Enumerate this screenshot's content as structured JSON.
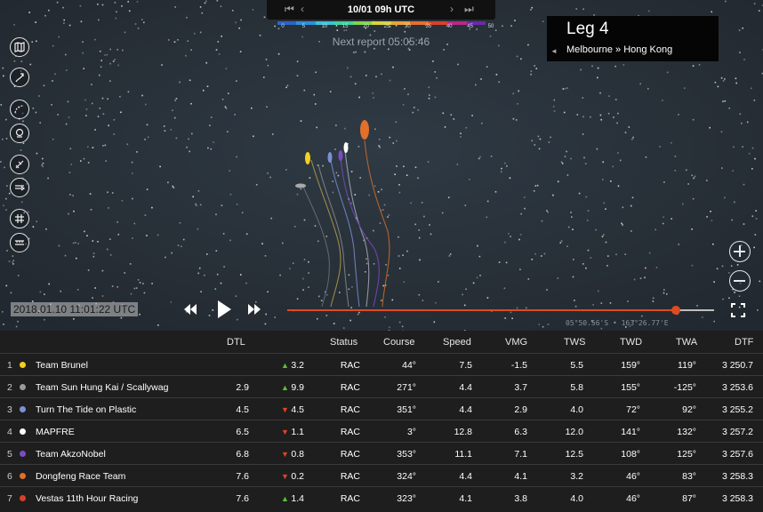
{
  "header": {
    "date": "10/01 09h UTC",
    "next_report": "Next report 05:05:46",
    "nav": {
      "first": "⏮",
      "prev": "‹",
      "next": "›",
      "last": "⏭"
    }
  },
  "wind_scale": {
    "labels": [
      "0",
      "5",
      "10",
      "15",
      "20",
      "25",
      "30",
      "35",
      "40",
      "45",
      "50"
    ],
    "colors": [
      "#2b64c8",
      "#2e8fd8",
      "#38c4d8",
      "#3fd39c",
      "#7fd44c",
      "#d9d43a",
      "#e8a33a",
      "#e3702e",
      "#d8402c",
      "#b8288a",
      "#6a2aa8"
    ]
  },
  "leg": {
    "title": "Leg 4",
    "route": "Melbourne » Hong Kong",
    "collapse": "◄"
  },
  "left_tools": [
    {
      "name": "map-layers-icon"
    },
    {
      "name": "boat-tracks-icon"
    },
    {
      "name": "routing-icon"
    },
    {
      "name": "boat-focus-icon"
    },
    {
      "name": "wind-icon"
    },
    {
      "name": "currents-icon"
    },
    {
      "name": "grid-icon"
    },
    {
      "name": "ruler-icon"
    }
  ],
  "playback": {
    "time": "2018.01.10 11:01:22 UTC",
    "progress": 0.91,
    "coords": "05°50.56'S • 163°26.77'E"
  },
  "boats_on_map": [
    {
      "color": "#f2d01e",
      "name": "brunel"
    },
    {
      "color": "#a9a9a9",
      "name": "scallywag"
    },
    {
      "color": "#7b90d6",
      "name": "turn-the-tide"
    },
    {
      "color": "#ffffff",
      "name": "mapfre"
    },
    {
      "color": "#7a4cc4",
      "name": "akzonobel"
    },
    {
      "color": "#e0702a",
      "name": "dongfeng"
    }
  ],
  "table": {
    "columns": [
      "DTL",
      "Status",
      "Course",
      "Speed",
      "VMG",
      "TWS",
      "TWD",
      "TWA",
      "DTF"
    ],
    "rows": [
      {
        "rank": "1",
        "color": "#f2d01e",
        "team": "Team Brunel",
        "dtl": "",
        "trend": "up",
        "change": "3.2",
        "status": "RAC",
        "course": "44°",
        "speed": "7.5",
        "vmg": "-1.5",
        "tws": "5.5",
        "twd": "159°",
        "twa": "119°",
        "dtf": "3 250.7"
      },
      {
        "rank": "2",
        "color": "#9a9a9a",
        "team": "Team Sun Hung Kai / Scallywag",
        "dtl": "2.9",
        "trend": "up",
        "change": "9.9",
        "status": "RAC",
        "course": "271°",
        "speed": "4.4",
        "vmg": "3.7",
        "tws": "5.8",
        "twd": "155°",
        "twa": "-125°",
        "dtf": "3 253.6"
      },
      {
        "rank": "3",
        "color": "#7b90d6",
        "team": "Turn The Tide on Plastic",
        "dtl": "4.5",
        "trend": "down",
        "change": "4.5",
        "status": "RAC",
        "course": "351°",
        "speed": "4.4",
        "vmg": "2.9",
        "tws": "4.0",
        "twd": "72°",
        "twa": "92°",
        "dtf": "3 255.2"
      },
      {
        "rank": "4",
        "color": "#ffffff",
        "team": "MAPFRE",
        "dtl": "6.5",
        "trend": "down",
        "change": "1.1",
        "status": "RAC",
        "course": "3°",
        "speed": "12.8",
        "vmg": "6.3",
        "tws": "12.0",
        "twd": "141°",
        "twa": "132°",
        "dtf": "3 257.2"
      },
      {
        "rank": "5",
        "color": "#7a4cc4",
        "team": "Team AkzoNobel",
        "dtl": "6.8",
        "trend": "down",
        "change": "0.8",
        "status": "RAC",
        "course": "353°",
        "speed": "11.1",
        "vmg": "7.1",
        "tws": "12.5",
        "twd": "108°",
        "twa": "125°",
        "dtf": "3 257.6"
      },
      {
        "rank": "6",
        "color": "#e0702a",
        "team": "Dongfeng Race Team",
        "dtl": "7.6",
        "trend": "down",
        "change": "0.2",
        "status": "RAC",
        "course": "324°",
        "speed": "4.4",
        "vmg": "4.1",
        "tws": "3.2",
        "twd": "46°",
        "twa": "83°",
        "dtf": "3 258.3"
      },
      {
        "rank": "7",
        "color": "#d8402c",
        "team": "Vestas 11th Hour Racing",
        "dtl": "7.6",
        "trend": "up",
        "change": "1.4",
        "status": "RAC",
        "course": "323°",
        "speed": "4.1",
        "vmg": "3.8",
        "tws": "4.0",
        "twd": "46°",
        "twa": "87°",
        "dtf": "3 258.3"
      }
    ]
  }
}
